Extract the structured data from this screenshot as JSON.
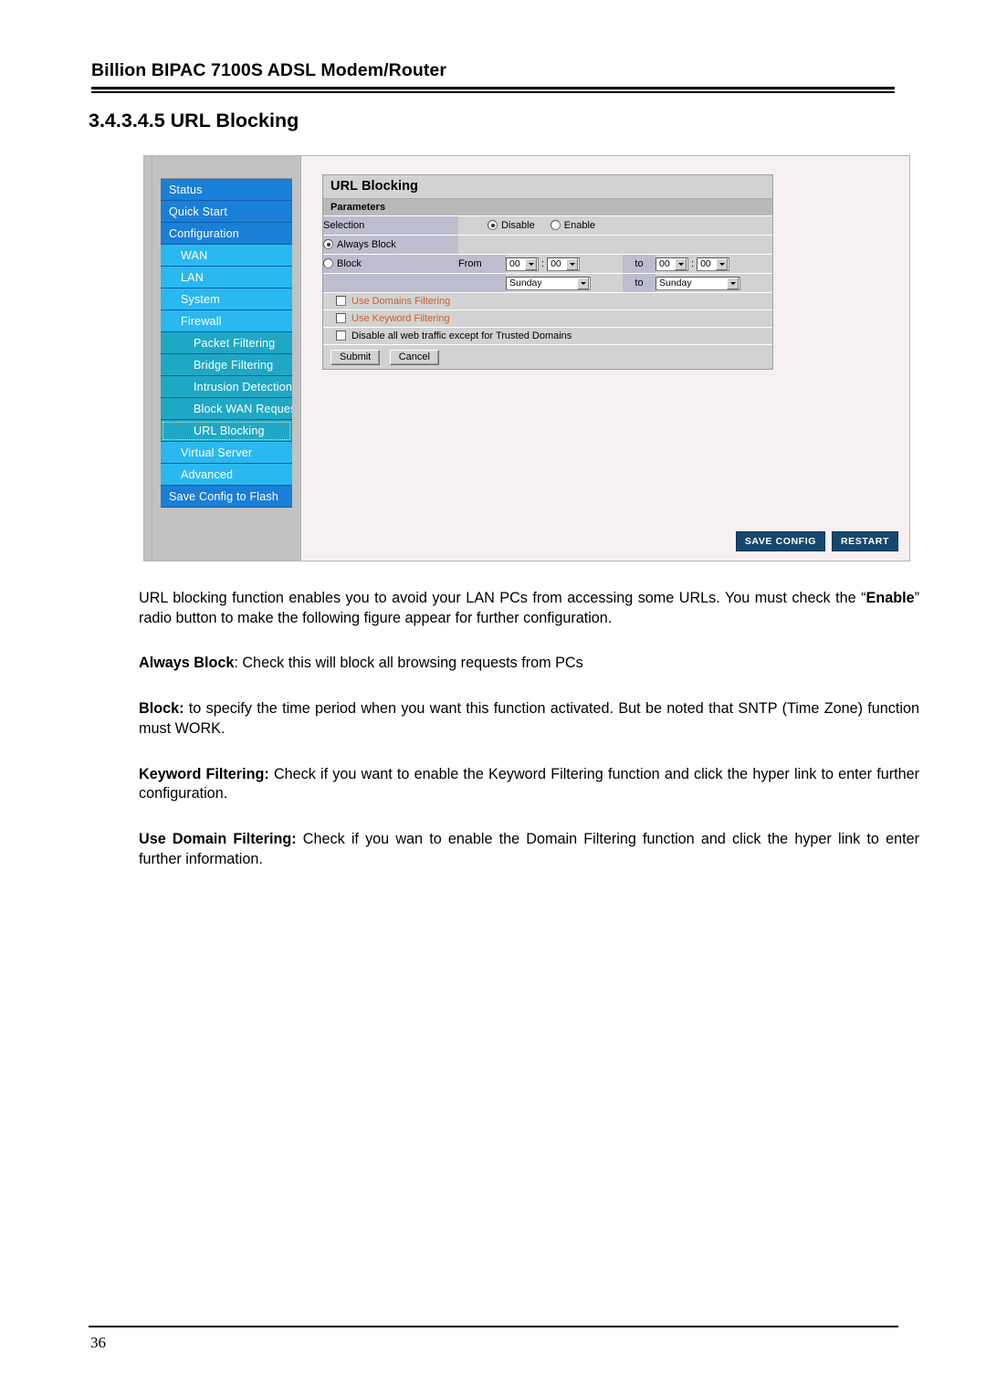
{
  "document": {
    "header_title": "Billion BIPAC 7100S ADSL Modem/Router",
    "section_title": "3.4.3.4.5 URL Blocking",
    "page_number": "36"
  },
  "figure": {
    "sidebar": {
      "items": [
        {
          "label": "Status",
          "level": 0,
          "active": false
        },
        {
          "label": "Quick Start",
          "level": 0,
          "active": false
        },
        {
          "label": "Configuration",
          "level": 0,
          "active": false
        },
        {
          "label": "WAN",
          "level": 1,
          "active": false
        },
        {
          "label": "LAN",
          "level": 1,
          "active": false
        },
        {
          "label": "System",
          "level": 1,
          "active": false
        },
        {
          "label": "Firewall",
          "level": 1,
          "active": false
        },
        {
          "label": "Packet Filtering",
          "level": 2,
          "active": false
        },
        {
          "label": "Bridge Filtering",
          "level": 2,
          "active": false
        },
        {
          "label": "Intrusion Detection",
          "level": 2,
          "active": false
        },
        {
          "label": "Block WAN Request",
          "level": 2,
          "active": false
        },
        {
          "label": "URL Blocking",
          "level": 2,
          "active": true
        },
        {
          "label": "Virtual Server",
          "level": 1,
          "active": false
        },
        {
          "label": "Advanced",
          "level": 1,
          "active": false
        },
        {
          "label": "Save Config to Flash",
          "level": 0,
          "active": false
        }
      ]
    },
    "panel": {
      "title": "URL Blocking",
      "subtitle": "Parameters",
      "selection": {
        "label": "Selection",
        "disable_label": "Disable",
        "enable_label": "Enable",
        "selected": "Disable"
      },
      "always_block": {
        "label": "Always Block",
        "selected": true
      },
      "block": {
        "label": "Block",
        "from_label": "From",
        "to_label": "to",
        "start_hour": "00",
        "start_minute": "00",
        "end_hour": "00",
        "end_minute": "00",
        "colon": ":"
      },
      "day_range": {
        "to_label": "to",
        "start_day": "Sunday",
        "end_day": "Sunday"
      },
      "checkboxes": [
        {
          "label": "Use Domains Filtering",
          "link": true,
          "checked": false
        },
        {
          "label": "Use Keyword Filtering",
          "link": true,
          "checked": false
        },
        {
          "label": "Disable all web traffic except for Trusted Domains",
          "link": false,
          "checked": false
        }
      ],
      "buttons": {
        "submit": "Submit",
        "cancel": "Cancel"
      }
    },
    "actions": {
      "save_config": "SAVE CONFIG",
      "restart": "RESTART"
    },
    "colors": {
      "nav_level0": "#1a7fd6",
      "nav_level1": "#2ab8f0",
      "nav_level2": "#1ea8c6",
      "label_cell": "#bdbdcf",
      "value_cell": "#d2d2d2",
      "link_orange": "#c8622b",
      "navy_button": "#16486e"
    }
  },
  "body": {
    "paragraphs": [
      {
        "id": "p-intro",
        "parts": [
          {
            "text": "URL blocking function enables you to avoid your LAN PCs from accessing some URLs. You must check the “",
            "bold": false
          },
          {
            "text": "Enable",
            "bold": true
          },
          {
            "text": "” radio button to make the following figure appear for further configuration.",
            "bold": false
          }
        ]
      },
      {
        "id": "p-always-block",
        "parts": [
          {
            "text": "Always Block",
            "bold": true
          },
          {
            "text": ": Check this will block all browsing requests from PCs",
            "bold": false
          }
        ]
      },
      {
        "id": "p-block",
        "parts": [
          {
            "text": "Block:",
            "bold": true
          },
          {
            "text": " to specify the time period when you want this function activated. But be noted that SNTP (Time Zone) function must WORK.",
            "bold": false
          }
        ]
      },
      {
        "id": "p-keyword-filtering",
        "parts": [
          {
            "text": "Keyword Filtering:",
            "bold": true
          },
          {
            "text": "  Check if you want to enable the Keyword Filtering function and click the hyper link to enter further configuration.",
            "bold": false
          }
        ]
      },
      {
        "id": "p-domain-filtering",
        "parts": [
          {
            "text": "Use Domain Filtering:",
            "bold": true
          },
          {
            "text": "  Check if you wan to enable the Domain Filtering function and click the hyper link to enter further information.",
            "bold": false
          }
        ]
      }
    ]
  }
}
